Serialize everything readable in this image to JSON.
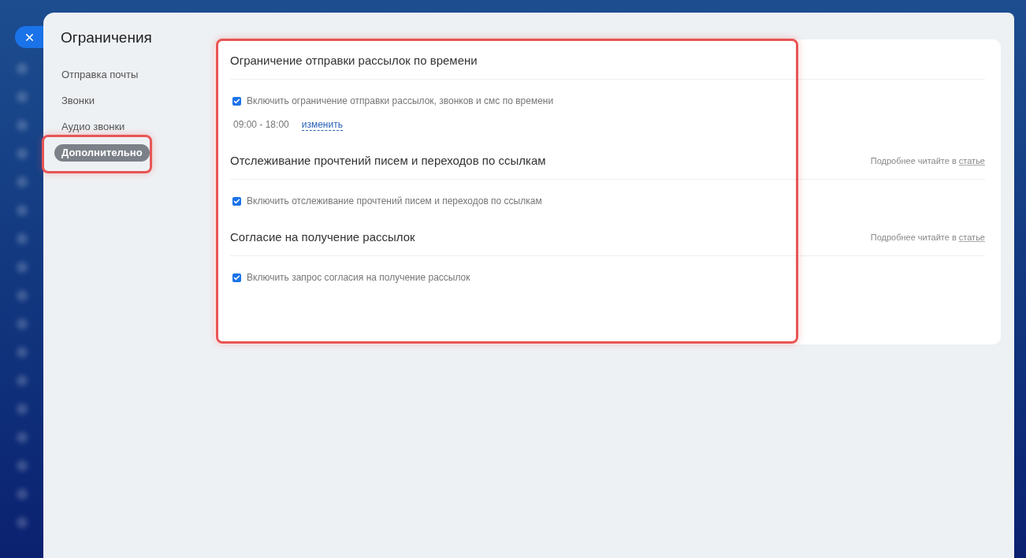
{
  "title": "Ограничения",
  "nav": [
    {
      "label": "Отправка почты",
      "selected": false
    },
    {
      "label": "Звонки",
      "selected": false
    },
    {
      "label": "Аудио звонки",
      "selected": false
    },
    {
      "label": "Дополнительно",
      "selected": true
    }
  ],
  "sections": [
    {
      "title": "Ограничение отправки рассылок по времени",
      "options": [
        {
          "label": "Включить ограничение отправки рассылок, звонков и смс по времени",
          "checked": true
        }
      ],
      "schedule": {
        "time": "09:00 - 18:00",
        "link": "изменить"
      }
    },
    {
      "title": "Отслеживание прочтений писем и переходов по ссылкам",
      "hint": {
        "text": "Подробнее читайте в",
        "link": "статье"
      },
      "options": [
        {
          "label": "Включить отслеживание прочтений писем и переходов по ссылкам",
          "checked": true
        }
      ]
    },
    {
      "title": "Согласие на получение рассылок",
      "hint": {
        "text": "Подробнее читайте в",
        "link": "статье"
      },
      "options": [
        {
          "label": "Включить запрос согласия на получение рассылок",
          "checked": true
        }
      ]
    }
  ]
}
